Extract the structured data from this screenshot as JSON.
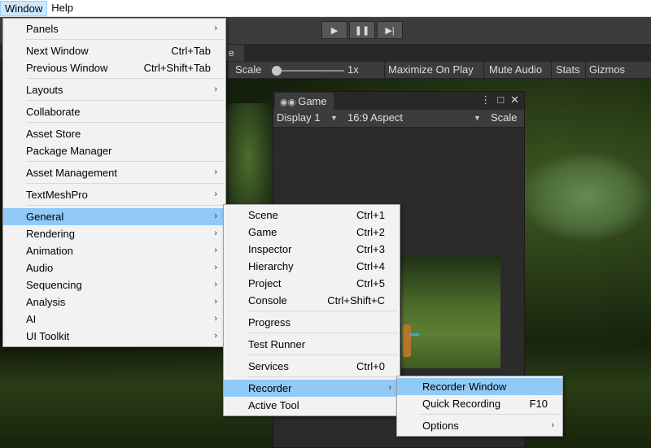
{
  "menubar": {
    "items": [
      {
        "label": "Window"
      },
      {
        "label": "Help"
      }
    ]
  },
  "playbar": {
    "play_icon": "▶",
    "pause_icon": "❚❚",
    "step_icon": "▶|"
  },
  "scene_tab_fragment": "e",
  "scene_toolbar": {
    "scale_label": "Scale",
    "scale_value": "1x",
    "maximize": "Maximize On Play",
    "mute": "Mute Audio",
    "stats": "Stats",
    "gizmos": "Gizmos"
  },
  "game_window": {
    "tab_icon": "gamepad-icon",
    "tab_title": "Game",
    "display": "Display 1",
    "aspect": "16:9 Aspect",
    "scale_label": "Scale",
    "controls": {
      "more": "⋮",
      "maximize": "□",
      "close": "✕"
    }
  },
  "window_menu": {
    "items": [
      {
        "label": "Panels",
        "shortcut": "",
        "submenu": true
      },
      {
        "label": "Next Window",
        "shortcut": "Ctrl+Tab",
        "submenu": false
      },
      {
        "label": "Previous Window",
        "shortcut": "Ctrl+Shift+Tab",
        "submenu": false
      },
      {
        "label": "Layouts",
        "shortcut": "",
        "submenu": true
      },
      {
        "label": "Collaborate",
        "shortcut": "",
        "submenu": false
      },
      {
        "label": "Asset Store",
        "shortcut": "",
        "submenu": false
      },
      {
        "label": "Package Manager",
        "shortcut": "",
        "submenu": false
      },
      {
        "label": "Asset Management",
        "shortcut": "",
        "submenu": true
      },
      {
        "label": "TextMeshPro",
        "shortcut": "",
        "submenu": true
      },
      {
        "label": "General",
        "shortcut": "",
        "submenu": true,
        "highlighted": true
      },
      {
        "label": "Rendering",
        "shortcut": "",
        "submenu": true
      },
      {
        "label": "Animation",
        "shortcut": "",
        "submenu": true
      },
      {
        "label": "Audio",
        "shortcut": "",
        "submenu": true
      },
      {
        "label": "Sequencing",
        "shortcut": "",
        "submenu": true
      },
      {
        "label": "Analysis",
        "shortcut": "",
        "submenu": true
      },
      {
        "label": "AI",
        "shortcut": "",
        "submenu": true
      },
      {
        "label": "UI Toolkit",
        "shortcut": "",
        "submenu": true
      }
    ]
  },
  "general_menu": {
    "items": [
      {
        "label": "Scene",
        "shortcut": "Ctrl+1"
      },
      {
        "label": "Game",
        "shortcut": "Ctrl+2"
      },
      {
        "label": "Inspector",
        "shortcut": "Ctrl+3"
      },
      {
        "label": "Hierarchy",
        "shortcut": "Ctrl+4"
      },
      {
        "label": "Project",
        "shortcut": "Ctrl+5"
      },
      {
        "label": "Console",
        "shortcut": "Ctrl+Shift+C"
      },
      {
        "label": "Progress",
        "shortcut": ""
      },
      {
        "label": "Test Runner",
        "shortcut": ""
      },
      {
        "label": "Services",
        "shortcut": "Ctrl+0"
      },
      {
        "label": "Recorder",
        "shortcut": "",
        "submenu": true,
        "highlighted": true
      },
      {
        "label": "Active Tool",
        "shortcut": ""
      }
    ]
  },
  "recorder_menu": {
    "items": [
      {
        "label": "Recorder Window",
        "shortcut": "",
        "highlighted": true
      },
      {
        "label": "Quick Recording",
        "shortcut": "F10"
      },
      {
        "label": "Options",
        "shortcut": "",
        "submenu": true
      }
    ]
  },
  "submenu_arrow": "›"
}
